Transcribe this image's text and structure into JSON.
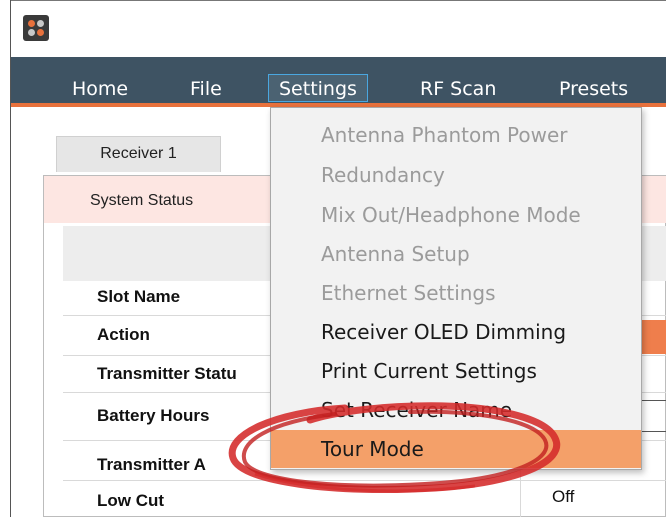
{
  "menubar": {
    "items": [
      {
        "label": "Home"
      },
      {
        "label": "File"
      },
      {
        "label": "Settings"
      },
      {
        "label": "RF Scan"
      },
      {
        "label": "Presets"
      }
    ]
  },
  "tabs": [
    {
      "label": "Receiver 1"
    }
  ],
  "section": {
    "title": "System Status"
  },
  "rows": [
    {
      "label": "Slot Name"
    },
    {
      "label": "Action"
    },
    {
      "label": "Transmitter Statu"
    },
    {
      "label": "Battery Hours"
    },
    {
      "label": "Transmitter A"
    },
    {
      "label": "Low Cut",
      "value": "Off"
    }
  ],
  "settings_menu": {
    "items": [
      {
        "label": "Antenna Phantom Power",
        "enabled": false
      },
      {
        "label": "Redundancy",
        "enabled": false
      },
      {
        "label": "Mix Out/Headphone Mode",
        "enabled": false
      },
      {
        "label": "Antenna Setup",
        "enabled": false
      },
      {
        "label": "Ethernet Settings",
        "enabled": false
      },
      {
        "label": "Receiver OLED Dimming",
        "enabled": true
      },
      {
        "label": "Print Current Settings",
        "enabled": true
      },
      {
        "label": "Set Receiver Name",
        "enabled": true
      },
      {
        "label": "Tour Mode",
        "enabled": true,
        "highlighted": true
      }
    ]
  },
  "colors": {
    "menubar_bg": "#3e5363",
    "accent": "#e8713c",
    "highlight": "#f4a069",
    "annotation": "#d42a2a"
  },
  "icons": {
    "app": "app-logo-icon"
  }
}
